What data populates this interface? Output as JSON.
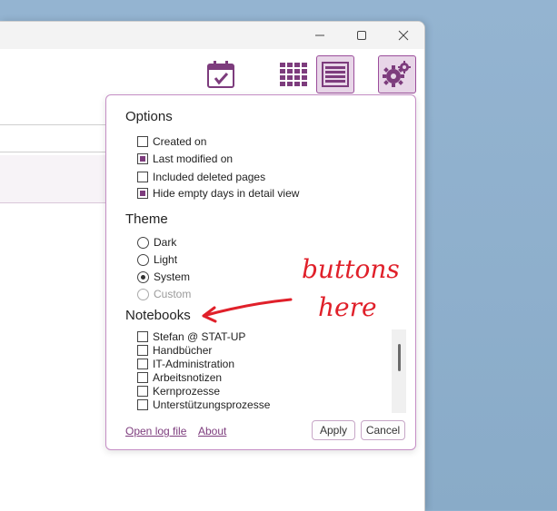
{
  "popup": {
    "options": {
      "title": "Options",
      "items": [
        {
          "label": "Created on",
          "checked": false
        },
        {
          "label": "Last modified on",
          "checked": true
        },
        {
          "label": "Included deleted pages",
          "checked": false
        },
        {
          "label": "Hide empty days in detail view",
          "checked": true
        }
      ]
    },
    "theme": {
      "title": "Theme",
      "items": [
        {
          "label": "Dark",
          "selected": false,
          "enabled": true
        },
        {
          "label": "Light",
          "selected": false,
          "enabled": true
        },
        {
          "label": "System",
          "selected": true,
          "enabled": true
        },
        {
          "label": "Custom",
          "selected": false,
          "enabled": false
        }
      ]
    },
    "notebooks": {
      "title": "Notebooks",
      "items": [
        {
          "label": "Stefan @ STAT-UP",
          "checked": false
        },
        {
          "label": "Handbücher",
          "checked": false
        },
        {
          "label": "IT-Administration",
          "checked": false
        },
        {
          "label": "Arbeitsnotizen",
          "checked": false
        },
        {
          "label": "Kernprozesse",
          "checked": false
        },
        {
          "label": "Unterstützungsprozesse",
          "checked": false
        }
      ]
    },
    "footer": {
      "open_log": "Open log file",
      "about": "About",
      "apply": "Apply",
      "cancel": "Cancel"
    }
  },
  "annotation": {
    "line1": "buttons",
    "line2": "here"
  },
  "colors": {
    "accent": "#7d3c7d",
    "accent_light": "#e8d6e8",
    "annotation": "#e0202a"
  },
  "icons": {
    "toolbar": [
      "calendar-check-icon",
      "grid-icon",
      "list-icon",
      "gear-icon"
    ],
    "window": [
      "minimize-icon",
      "maximize-icon",
      "close-icon"
    ]
  }
}
